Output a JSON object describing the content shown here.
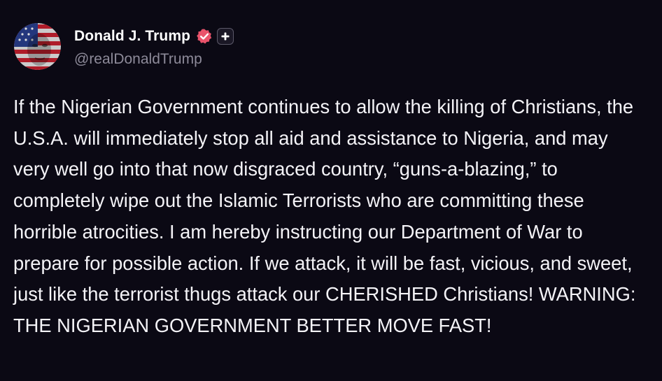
{
  "post": {
    "author": {
      "display_name": "Donald J. Trump",
      "handle": "@realDonaldTrump",
      "avatar_icon": "flag-face-avatar",
      "verified_icon": "verified-badge-icon",
      "verified_color": "#e9536b",
      "plus_icon": "plus-icon"
    },
    "body": "If the Nigerian Government continues to allow the killing of Christians, the U.S.A. will immediately stop all aid and assistance to Nigeria, and may very well go into that now disgraced country, “guns-a-blazing,” to completely wipe out the Islamic Terrorists who are committing these horrible atrocities. I am hereby instructing our Department of War to prepare for possible action. If we attack, it will be fast, vicious, and sweet, just like the terrorist thugs attack our CHERISHED Christians! WARNING: THE NIGERIAN GOVERNMENT BETTER MOVE FAST!"
  },
  "colors": {
    "background": "#0b0914",
    "text": "#f4f3f7",
    "handle": "#8d8a99",
    "accent": "#e9536b"
  }
}
